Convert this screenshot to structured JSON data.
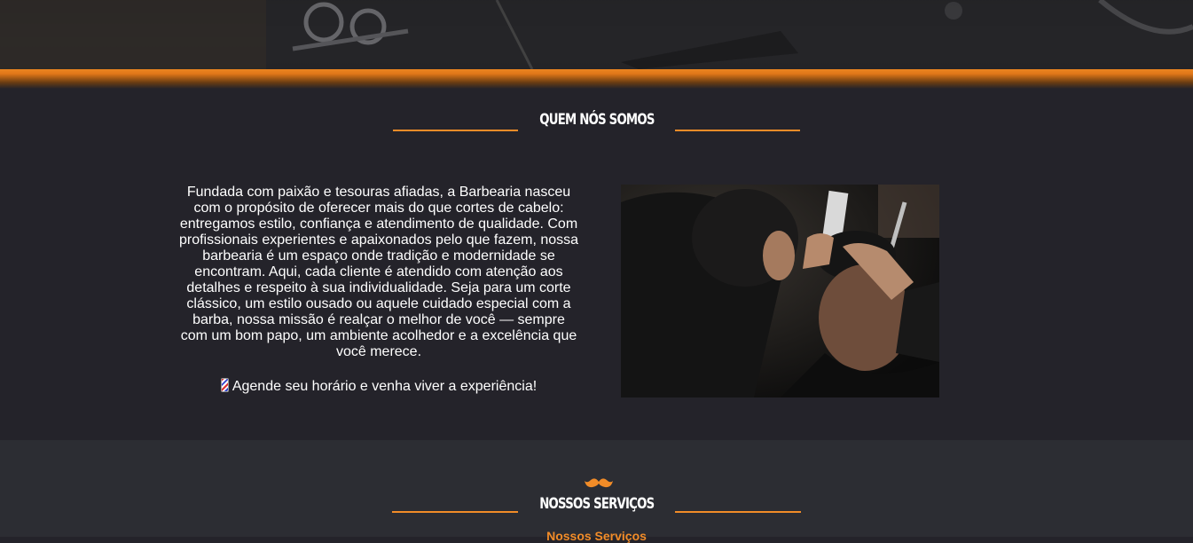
{
  "about": {
    "title": "QUEM NÓS SOMOS",
    "paragraph": "Fundada com paixão e tesouras afiadas, a Barbearia nasceu com o propósito de oferecer mais do que cortes de cabelo: entregamos estilo, confiança e atendimento de qualidade. Com profissionais experientes e apaixonados pelo que fazem, nossa barbearia é um espaço onde tradição e modernidade se encontram. Aqui, cada cliente é atendido com atenção aos detalhes e respeito à sua individualidade. Seja para um corte clássico, um estilo ousado ou aquele cuidado especial com a barba, nossa missão é realçar o melhor de você — sempre com um bom papo, um ambiente acolhedor e a excelência que você merece.",
    "cta": "Agende seu horário e venha viver a experiência!",
    "cta_icon": "barber-pole-icon",
    "image": "barber-cutting-hair-photo"
  },
  "services": {
    "icon": "mustache-icon",
    "title": "NOSSOS SERVIÇOS",
    "subtitle": "Nossos Serviços"
  },
  "colors": {
    "accent": "#f28c28",
    "background_dark": "#24232a",
    "background_services": "#2c2d33",
    "text": "#ffffff"
  }
}
